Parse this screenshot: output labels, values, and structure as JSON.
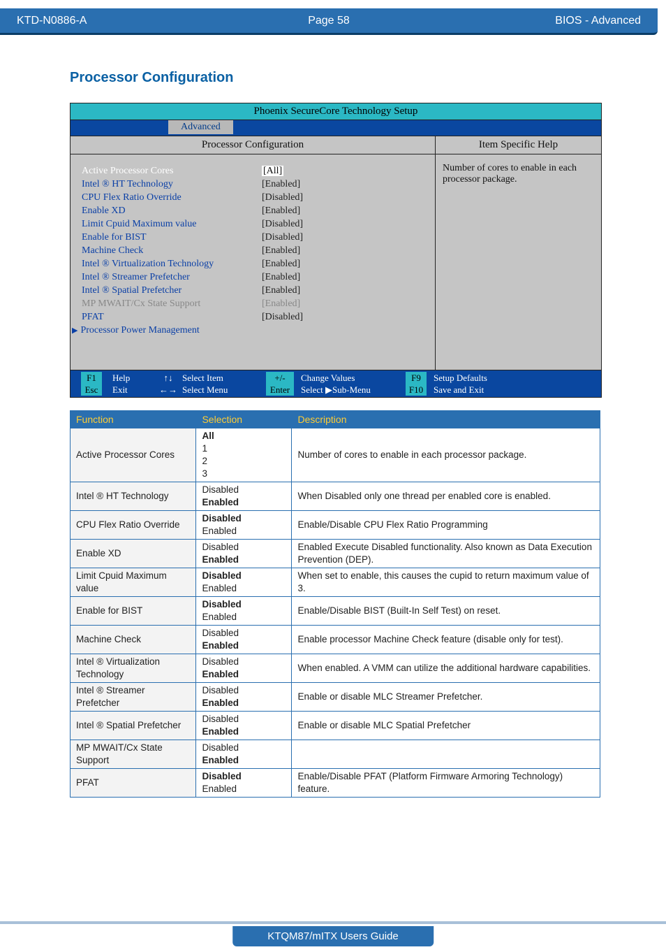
{
  "header": {
    "doc_id": "KTD-N0886-A",
    "page_label": "Page 58",
    "section_label": "BIOS  - Advanced"
  },
  "section_title": "Processor Configuration",
  "bios": {
    "title": "Phoenix SecureCore Technology Setup",
    "active_tab": "Advanced",
    "panel_title_left": "Processor Configuration",
    "panel_title_right": "Item Specific Help",
    "help_text": "Number of cores to enable in each processor package.",
    "items": [
      {
        "label": "Active Processor Cores",
        "value": "[All]",
        "state": "active",
        "highlighted": true
      },
      {
        "label": "Intel ® HT Technology",
        "value": "[Enabled]"
      },
      {
        "label": "CPU Flex Ratio Override",
        "value": "[Disabled]"
      },
      {
        "label": "Enable XD",
        "value": "[Enabled]"
      },
      {
        "label": "Limit Cpuid Maximum value",
        "value": "[Disabled]"
      },
      {
        "label": "Enable for BIST",
        "value": "[Disabled]"
      },
      {
        "label": "Machine Check",
        "value": "[Enabled]"
      },
      {
        "label": "Intel ® Virtualization Technology",
        "value": "[Enabled]"
      },
      {
        "label": "Intel ® Streamer Prefetcher",
        "value": "[Enabled]"
      },
      {
        "label": "Intel ® Spatial Prefetcher",
        "value": "[Enabled]"
      },
      {
        "label": "MP MWAIT/Cx State Support",
        "value": "[Enabled]",
        "state": "disabled"
      },
      {
        "label": "PFAT",
        "value": "[Disabled]"
      },
      {
        "label": "Processor Power Management",
        "value": "",
        "submenu": true
      }
    ],
    "footer": {
      "f1": "F1",
      "help": "Help",
      "arrows_ud": "↑↓",
      "select_item": "Select Item",
      "plusminus": "+/-",
      "change_values": "Change Values",
      "f9": "F9",
      "setup_defaults": "Setup Defaults",
      "esc": "Esc",
      "exit": "Exit",
      "arrows_lr": "←→",
      "select_menu": "Select Menu",
      "enter": "Enter",
      "select_submenu": "Select ▶Sub-Menu",
      "f10": "F10",
      "save_exit": "Save and Exit"
    }
  },
  "table": {
    "headers": {
      "fn": "Function",
      "sel": "Selection",
      "desc": "Description"
    },
    "rows": [
      {
        "fn": "Active Processor Cores",
        "selections": [
          {
            "text": "All",
            "bold": true
          },
          {
            "text": "1"
          },
          {
            "text": "2"
          },
          {
            "text": "3"
          }
        ],
        "desc": "Number of cores to enable in each processor package."
      },
      {
        "fn": "Intel ® HT Technology",
        "selections": [
          {
            "text": "Disabled"
          },
          {
            "text": "Enabled",
            "bold": true
          }
        ],
        "desc": "When Disabled only one thread per enabled core is enabled."
      },
      {
        "fn": "CPU Flex Ratio Override",
        "selections": [
          {
            "text": "Disabled",
            "bold": true
          },
          {
            "text": "Enabled"
          }
        ],
        "desc": "Enable/Disable CPU Flex Ratio Programming"
      },
      {
        "fn": "Enable XD",
        "selections": [
          {
            "text": "Disabled"
          },
          {
            "text": "Enabled",
            "bold": true
          }
        ],
        "desc": "Enabled Execute Disabled functionality. Also known as Data Execution Prevention (DEP)."
      },
      {
        "fn": "Limit Cpuid Maximum value",
        "selections": [
          {
            "text": "Disabled",
            "bold": true
          },
          {
            "text": "Enabled"
          }
        ],
        "desc": "When set to enable, this causes the cupid to return maximum value of 3."
      },
      {
        "fn": "Enable for BIST",
        "selections": [
          {
            "text": "Disabled",
            "bold": true
          },
          {
            "text": "Enabled"
          }
        ],
        "desc": "Enable/Disable BIST (Built-In Self Test) on reset."
      },
      {
        "fn": "Machine Check",
        "selections": [
          {
            "text": "Disabled"
          },
          {
            "text": "Enabled",
            "bold": true
          }
        ],
        "desc": "Enable processor Machine Check feature (disable only for test)."
      },
      {
        "fn": "Intel ® Virtualization Technology",
        "selections": [
          {
            "text": "Disabled"
          },
          {
            "text": "Enabled",
            "bold": true
          }
        ],
        "desc": "When enabled. A VMM can utilize the additional hardware capabilities."
      },
      {
        "fn": "Intel ® Streamer Prefetcher",
        "selections": [
          {
            "text": "Disabled"
          },
          {
            "text": "Enabled",
            "bold": true
          }
        ],
        "desc": "Enable or disable MLC Streamer Prefetcher."
      },
      {
        "fn": "Intel ® Spatial Prefetcher",
        "selections": [
          {
            "text": "Disabled"
          },
          {
            "text": "Enabled",
            "bold": true
          }
        ],
        "desc": "Enable or disable MLC Spatial Prefetcher"
      },
      {
        "fn": "MP MWAIT/Cx State Support",
        "selections": [
          {
            "text": "Disabled"
          },
          {
            "text": "Enabled",
            "bold": true
          }
        ],
        "desc": ""
      },
      {
        "fn": "PFAT",
        "selections": [
          {
            "text": "Disabled",
            "bold": true
          },
          {
            "text": "Enabled"
          }
        ],
        "desc": "Enable/Disable PFAT (Platform Firmware Armoring Technology) feature."
      }
    ]
  },
  "footer_title": "KTQM87/mITX Users Guide"
}
